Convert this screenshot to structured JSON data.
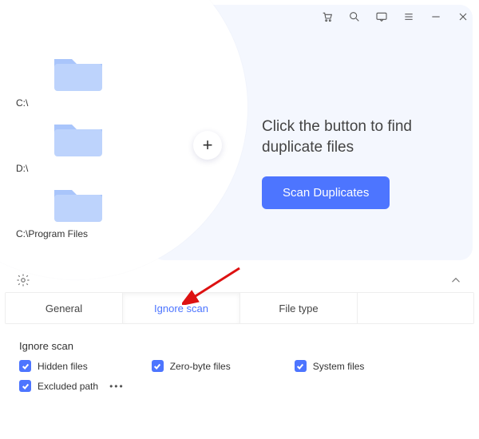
{
  "titlebar": {
    "icons": [
      "cart-icon",
      "search-icon",
      "feedback-icon",
      "menu-icon",
      "minimize-icon",
      "close-icon"
    ]
  },
  "folders": [
    {
      "path": "C:\\"
    },
    {
      "path": "D:\\"
    },
    {
      "path": "C:\\Program Files"
    }
  ],
  "add_tooltip": "+",
  "cta": {
    "line1": "Click the button to find",
    "line2": "duplicate files",
    "button": "Scan Duplicates"
  },
  "tabs": {
    "items": [
      "General",
      "Ignore scan",
      "File type"
    ],
    "active_index": 1
  },
  "panel": {
    "title": "Ignore scan",
    "options_row1": [
      {
        "label": "Hidden files",
        "checked": true
      },
      {
        "label": "Zero-byte files",
        "checked": true
      },
      {
        "label": "System files",
        "checked": true
      }
    ],
    "options_row2": [
      {
        "label": "Excluded path",
        "checked": true,
        "has_more": true
      }
    ]
  },
  "colors": {
    "accent": "#4d75ff",
    "folder_light": "#bdd3fc",
    "folder_dark": "#a9c5fb"
  }
}
